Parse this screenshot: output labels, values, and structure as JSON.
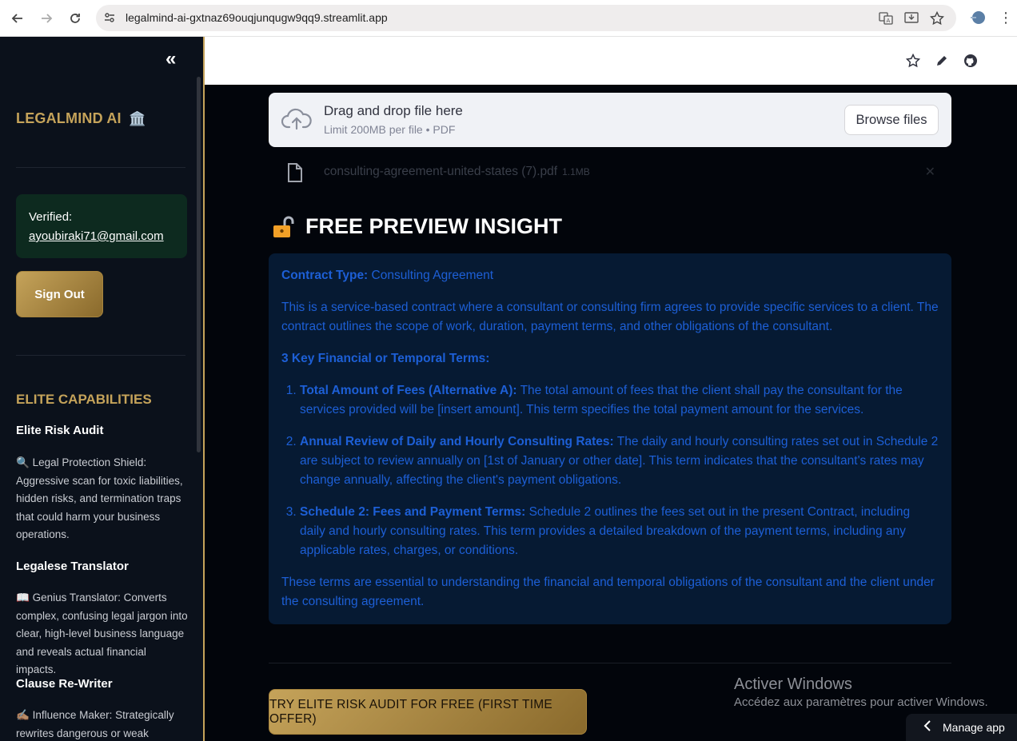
{
  "browser": {
    "url": "legalmind-ai-gxtnaz69ouqjunqugw9qq9.streamlit.app"
  },
  "sidebar": {
    "brand": "LEGALMIND AI",
    "brand_icon": "🏛️",
    "verified_label": "Verified:",
    "verified_email": "ayoubiraki71@gmail.com",
    "signout_label": "Sign Out",
    "capabilities_title": "ELITE CAPABILITIES",
    "capabilities": [
      {
        "name": "Elite Risk Audit",
        "icon": "🔍",
        "desc": "Legal Protection Shield: Aggressive scan for toxic liabilities, hidden risks, and termination traps that could harm your business operations."
      },
      {
        "name": "Legalese Translator",
        "icon": "📖",
        "desc": "Genius Translator: Converts complex, confusing legal jargon into clear, high-level business language and reveals actual financial impacts."
      },
      {
        "name": "Clause Re-Writer",
        "icon": "✍🏽",
        "desc": "Influence Maker: Strategically rewrites dangerous or weak clauses"
      }
    ]
  },
  "uploader": {
    "title": "Drag and drop file here",
    "limit": "Limit 200MB per file • PDF",
    "browse_label": "Browse files",
    "file_name": "consulting-agreement-united-states (7).pdf",
    "file_size": "1.1MB"
  },
  "preview": {
    "title": "FREE PREVIEW INSIGHT",
    "contract_type_label": "Contract Type:",
    "contract_type_value": "Consulting Agreement",
    "summary": "This is a service-based contract where a consultant or consulting firm agrees to provide specific services to a client. The contract outlines the scope of work, duration, payment terms, and other obligations of the consultant.",
    "key_terms_heading": "3 Key Financial or Temporal Terms:",
    "terms": [
      {
        "title": "Total Amount of Fees (Alternative A):",
        "text": "The total amount of fees that the client shall pay the consultant for the services provided will be [insert amount]. This term specifies the total payment amount for the services."
      },
      {
        "title": "Annual Review of Daily and Hourly Consulting Rates:",
        "text": "The daily and hourly consulting rates set out in Schedule 2 are subject to review annually on [1st of January or other date]. This term indicates that the consultant's rates may change annually, affecting the client's payment obligations."
      },
      {
        "title": "Schedule 2: Fees and Payment Terms:",
        "text": "Schedule 2 outlines the fees set out in the present Contract, including daily and hourly consulting rates. This term provides a detailed breakdown of the payment terms, including any applicable rates, charges, or conditions."
      }
    ],
    "conclusion": "These terms are essential to understanding the financial and temporal obligations of the consultant and the client under the consulting agreement."
  },
  "cta_label": "TRY ELITE RISK AUDIT FOR FREE (FIRST TIME OFFER)",
  "windows_watermark": {
    "line1": "Activer Windows",
    "line2": "Accédez aux paramètres pour activer Windows."
  },
  "manage_app_label": "Manage app",
  "colors": {
    "gold": "#c5a35a",
    "sidebar_bg": "#0b111b",
    "insight_text": "#1d5fd6",
    "verified_bg": "#0d2a1f"
  }
}
